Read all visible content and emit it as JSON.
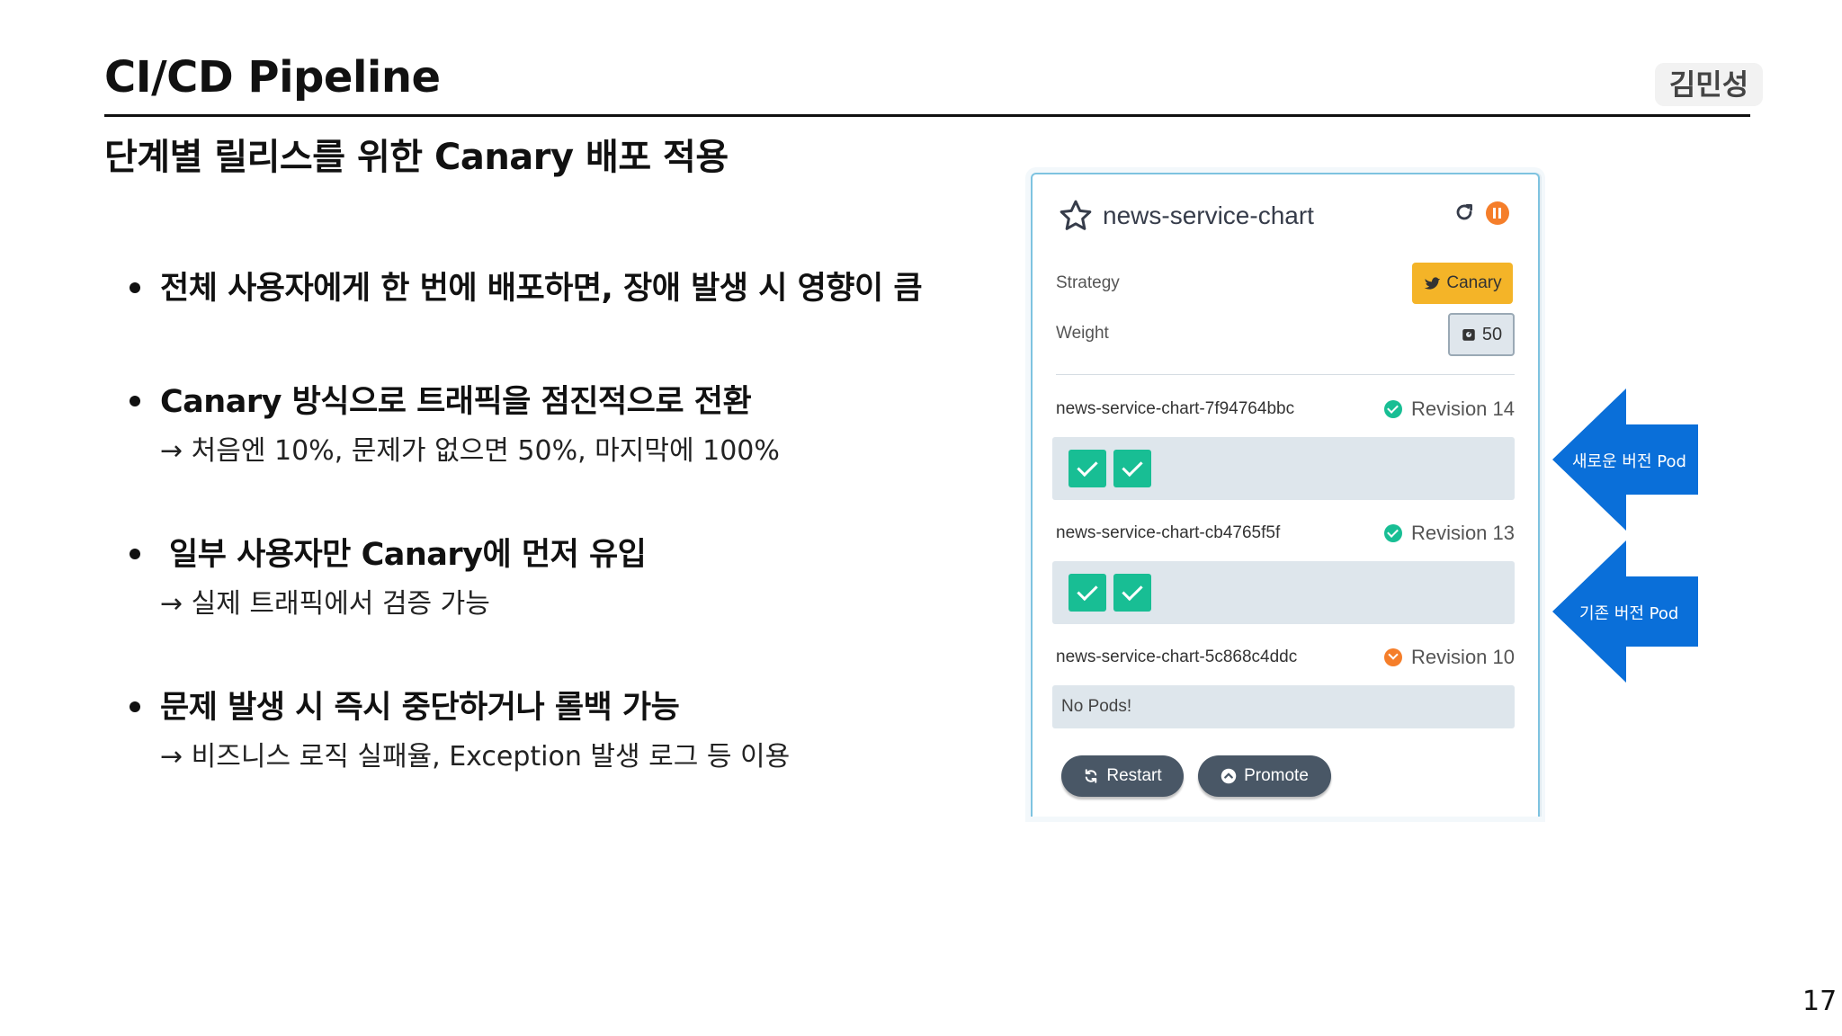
{
  "slide": {
    "title": "CI/CD Pipeline",
    "author": "김민성",
    "subtitle": "단계별 릴리스를 위한 Canary 배포 적용",
    "page_number": "17"
  },
  "bullets": [
    {
      "head": "전체 사용자에게 한 번에 배포하면, 장애 발생 시 영향이 큼",
      "sub": ""
    },
    {
      "head": "Canary 방식으로 트래픽을 점진적으로 전환",
      "sub": "→ 처음엔 10%, 문제가 없으면 50%, 마지막에 100%"
    },
    {
      "head": "일부 사용자만 Canary에 먼저 유입",
      "sub": "→ 실제 트래픽에서 검증 가능"
    },
    {
      "head": "문제 발생 시 즉시 중단하거나 롤백 가능",
      "sub": "→ 비즈니스 로직 실패율, Exception 발생 로그 등 이용"
    }
  ],
  "rollout": {
    "name": "news-service-chart",
    "strategy_label": "Strategy",
    "strategy_value": "Canary",
    "weight_label": "Weight",
    "weight_value": "50",
    "revisions": [
      {
        "name": "news-service-chart-7f94764bbc",
        "revision": "Revision 14",
        "status": "healthy",
        "pods": 2
      },
      {
        "name": "news-service-chart-cb4765f5f",
        "revision": "Revision 13",
        "status": "healthy",
        "pods": 2
      },
      {
        "name": "news-service-chart-5c868c4ddc",
        "revision": "Revision 10",
        "status": "scaled-down",
        "pods": 0,
        "empty_text": "No Pods!"
      }
    ],
    "restart_label": "Restart",
    "promote_label": "Promote"
  },
  "annotations": {
    "new_pod": "새로운 버전 Pod",
    "old_pod": "기존 버전 Pod"
  },
  "colors": {
    "arrow": "#0a6fd9",
    "canary_badge": "#f4b428",
    "healthy": "#18be94",
    "paused": "#f57e2a",
    "button": "#495766"
  }
}
